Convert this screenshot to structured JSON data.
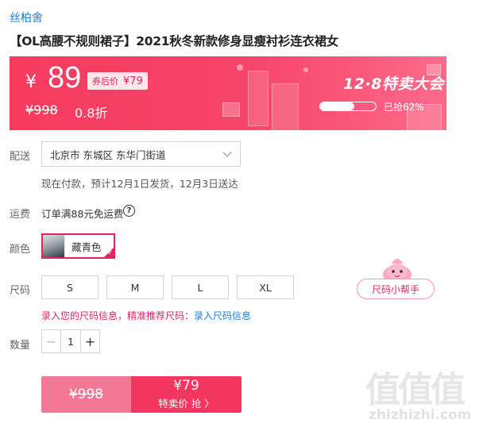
{
  "store": {
    "name": "丝柏舍"
  },
  "product": {
    "title": "【OL高腰不规则裙子】2021秋冬新款修身显瘦衬衫连衣裙女"
  },
  "price_banner": {
    "currency": "¥",
    "price": "89",
    "coupon_label": "券后价",
    "coupon_price": "¥79",
    "original_price": "¥998",
    "discount": "0.8折",
    "event_name": "12·8特卖大会",
    "sold_progress": 0.62,
    "sold_text": "已抢62%",
    "accent_color": "#f63a5e"
  },
  "delivery": {
    "label": "配送",
    "address": "北京市 东城区 东华门街道",
    "note": "现在付款，预计12月1日发货，12月3日送达"
  },
  "shipping": {
    "label": "运费",
    "text": "订单满88元免运费",
    "icon": "question-circle-icon"
  },
  "color": {
    "label": "颜色",
    "selected": "藏青色"
  },
  "size": {
    "label": "尺码",
    "options": [
      "S",
      "M",
      "L",
      "XL"
    ],
    "helper": "尺码小帮手",
    "info_text": "录入您的尺码信息，精准推荐尺码：",
    "info_link": "录入尺码信息"
  },
  "quantity": {
    "label": "数量",
    "value": "1",
    "minus": "−",
    "plus": "+"
  },
  "buy_bar": {
    "original_price": "¥998",
    "price": "¥79",
    "cta": "特卖价 抢 〉"
  },
  "watermark": {
    "glyphs": "值值值",
    "text": "zhizhizhi.com"
  }
}
